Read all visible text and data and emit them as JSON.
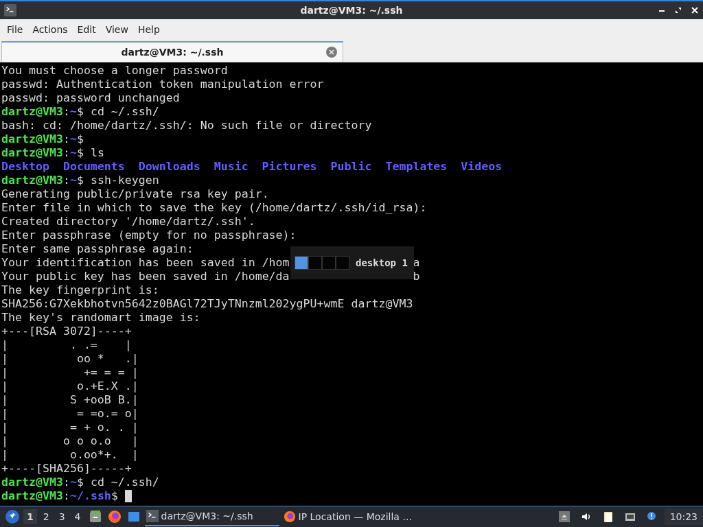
{
  "window": {
    "title": "dartz@VM3: ~/.ssh"
  },
  "menu": [
    "File",
    "Actions",
    "Edit",
    "View",
    "Help"
  ],
  "tabs": [
    {
      "label": "dartz@VM3: ~/.ssh",
      "selected": true
    }
  ],
  "terminal": {
    "lines": [
      [
        {
          "kind": "text",
          "text": "You must choose a longer password"
        }
      ],
      [
        {
          "kind": "text",
          "text": "passwd: Authentication token manipulation error"
        }
      ],
      [
        {
          "kind": "text",
          "text": "passwd: password unchanged"
        }
      ],
      [
        {
          "kind": "user",
          "text": "dartz@VM3"
        },
        {
          "kind": "text",
          "text": ":"
        },
        {
          "kind": "path",
          "text": "~"
        },
        {
          "kind": "text",
          "text": "$ cd ~/.ssh/"
        }
      ],
      [
        {
          "kind": "text",
          "text": "bash: cd: /home/dartz/.ssh/: No such file or directory"
        }
      ],
      [
        {
          "kind": "user",
          "text": "dartz@VM3"
        },
        {
          "kind": "text",
          "text": ":"
        },
        {
          "kind": "path",
          "text": "~"
        },
        {
          "kind": "text",
          "text": "$"
        }
      ],
      [
        {
          "kind": "user",
          "text": "dartz@VM3"
        },
        {
          "kind": "text",
          "text": ":"
        },
        {
          "kind": "path",
          "text": "~"
        },
        {
          "kind": "text",
          "text": "$ ls"
        }
      ],
      [
        {
          "kind": "dir",
          "text": "Desktop"
        },
        {
          "kind": "dir",
          "text": "Documents"
        },
        {
          "kind": "dir",
          "text": "Downloads"
        },
        {
          "kind": "dir",
          "text": "Music"
        },
        {
          "kind": "dir",
          "text": "Pictures"
        },
        {
          "kind": "dir",
          "text": "Public"
        },
        {
          "kind": "dir",
          "text": "Templates"
        },
        {
          "kind": "dir",
          "text": "Videos"
        }
      ],
      [
        {
          "kind": "user",
          "text": "dartz@VM3"
        },
        {
          "kind": "text",
          "text": ":"
        },
        {
          "kind": "path",
          "text": "~"
        },
        {
          "kind": "text",
          "text": "$ ssh-keygen"
        }
      ],
      [
        {
          "kind": "text",
          "text": "Generating public/private rsa key pair."
        }
      ],
      [
        {
          "kind": "text",
          "text": "Enter file in which to save the key (/home/dartz/.ssh/id_rsa):"
        }
      ],
      [
        {
          "kind": "text",
          "text": "Created directory '/home/dartz/.ssh'."
        }
      ],
      [
        {
          "kind": "text",
          "text": "Enter passphrase (empty for no passphrase):"
        }
      ],
      [
        {
          "kind": "text",
          "text": "Enter same passphrase again:"
        }
      ],
      [
        {
          "kind": "text",
          "text": "Your identification has been saved in /hom"
        },
        {
          "kind": "covered"
        },
        {
          "kind": "text",
          "text": "a"
        }
      ],
      [
        {
          "kind": "text",
          "text": "Your public key has been saved in /home/da"
        },
        {
          "kind": "covered"
        },
        {
          "kind": "text",
          "text": "b"
        }
      ],
      [
        {
          "kind": "text",
          "text": "The key fingerprint is:"
        }
      ],
      [
        {
          "kind": "text",
          "text": "SHA256:G7Xekbhotvn5642z0BAGl72TJyTNnzml202ygPU+wmE dartz@VM3"
        }
      ],
      [
        {
          "kind": "text",
          "text": "The key's randomart image is:"
        }
      ],
      [
        {
          "kind": "text",
          "text": "+---[RSA 3072]----+"
        }
      ],
      [
        {
          "kind": "text",
          "text": "|         . .=    |"
        }
      ],
      [
        {
          "kind": "text",
          "text": "|          oo *   .|"
        }
      ],
      [
        {
          "kind": "text",
          "text": "|           += = = |"
        }
      ],
      [
        {
          "kind": "text",
          "text": "|          o.+E.X .|"
        }
      ],
      [
        {
          "kind": "text",
          "text": "|         S +ooB B.|"
        }
      ],
      [
        {
          "kind": "text",
          "text": "|          = =o.= o|"
        }
      ],
      [
        {
          "kind": "text",
          "text": "|         = + o. . |"
        }
      ],
      [
        {
          "kind": "text",
          "text": "|        o o o.o   |"
        }
      ],
      [
        {
          "kind": "text",
          "text": "|         o.oo*+.  |"
        }
      ],
      [
        {
          "kind": "text",
          "text": "+----[SHA256]-----+"
        }
      ],
      [
        {
          "kind": "user",
          "text": "dartz@VM3"
        },
        {
          "kind": "text",
          "text": ":"
        },
        {
          "kind": "path",
          "text": "~"
        },
        {
          "kind": "text",
          "text": "$ cd ~/.ssh/"
        }
      ],
      [
        {
          "kind": "user",
          "text": "dartz@VM3"
        },
        {
          "kind": "text",
          "text": ":"
        },
        {
          "kind": "path",
          "text": "~/.ssh"
        },
        {
          "kind": "text",
          "text": "$ "
        },
        {
          "kind": "cursor"
        }
      ]
    ]
  },
  "desktop_popup": {
    "desktops": [
      {
        "selected": true
      },
      {
        "selected": false
      },
      {
        "selected": false
      },
      {
        "selected": false
      }
    ],
    "label": "desktop 1"
  },
  "taskbar": {
    "desktops": [
      {
        "label": "1",
        "selected": true
      },
      {
        "label": "2",
        "selected": false
      },
      {
        "label": "3",
        "selected": false
      },
      {
        "label": "4",
        "selected": false
      }
    ],
    "tasks": [
      {
        "kind": "terminal",
        "label": "dartz@VM3: ~/.ssh",
        "selected": true
      },
      {
        "kind": "browser",
        "label": "IP Location — Mozilla …",
        "selected": false
      }
    ],
    "clock": "10:23"
  }
}
